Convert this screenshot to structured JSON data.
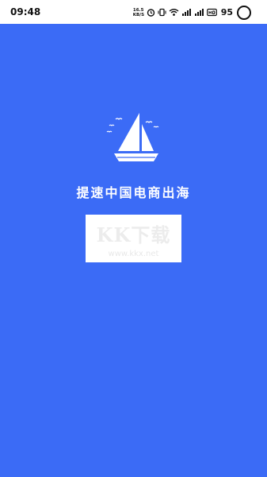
{
  "status_bar": {
    "time": "09:48",
    "network_speed": "16.5",
    "network_speed_unit": "KB/S",
    "battery_percent": "95",
    "icons": [
      "alarm-icon",
      "vibrate-icon",
      "wifi-icon",
      "signal-icon",
      "signal-icon",
      "hd-icon"
    ]
  },
  "splash": {
    "tagline": "提速中国电商出海",
    "logo_icon": "sailboat-icon",
    "background_color": "#3b6bf6"
  },
  "watermark": {
    "title": "KK下载",
    "url": "www.kkx.net"
  }
}
